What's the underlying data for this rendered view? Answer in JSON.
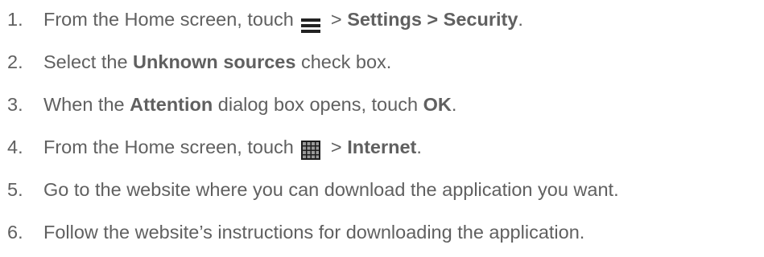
{
  "icons": {
    "menu": "menu-icon",
    "apps": "apps-grid-icon"
  },
  "steps": [
    {
      "number": "1.",
      "before": "From the Home screen, touch ",
      "after": " > ",
      "bold": "Settings > Security",
      "end": "."
    },
    {
      "number": "2.",
      "before": "Select the ",
      "bold": "Unknown sources",
      "after": " check box."
    },
    {
      "number": "3.",
      "before": "When the ",
      "bold": "Attention",
      "middle": " dialog box opens, touch ",
      "bold2": "OK",
      "end": "."
    },
    {
      "number": "4.",
      "before": "From the Home screen, touch ",
      "after": " > ",
      "bold": "Internet",
      "end": "."
    },
    {
      "number": "5.",
      "text": "Go to the website where you can download the application you want."
    },
    {
      "number": "6.",
      "text": "Follow the website’s instructions for downloading the application."
    }
  ]
}
